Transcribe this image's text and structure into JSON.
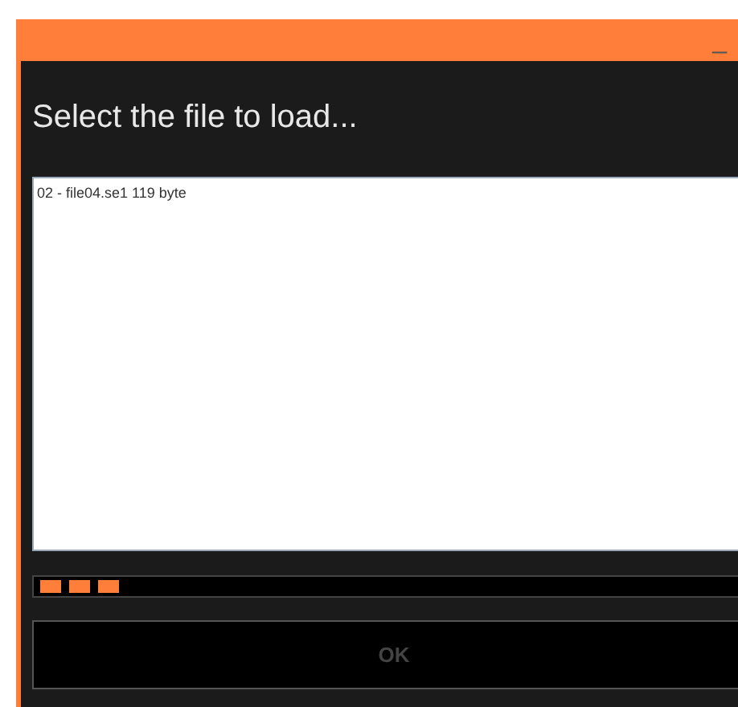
{
  "window": {
    "controls": [
      "_"
    ]
  },
  "title": "Select the file to load...",
  "files": [
    {
      "label": "02 - file04.se1 119 byte",
      "selected": false
    }
  ],
  "progress": {
    "level": 0.12
  },
  "ok_button": {
    "label": "OK",
    "disabled": true
  }
}
